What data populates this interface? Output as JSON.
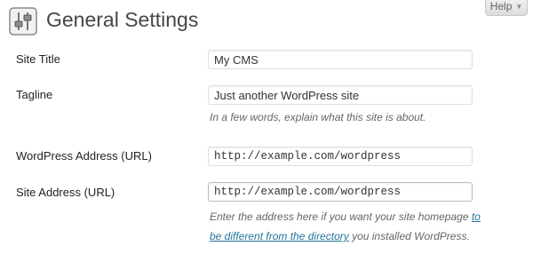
{
  "header": {
    "title": "General Settings",
    "icon": "settings-sliders-icon"
  },
  "help": {
    "label": "Help",
    "icon": "caret-down-icon"
  },
  "fields": {
    "site_title": {
      "label": "Site Title",
      "value": "My CMS"
    },
    "tagline": {
      "label": "Tagline",
      "value": "Just another WordPress site",
      "description": "In a few words, explain what this site is about."
    },
    "wp_address": {
      "label": "WordPress Address (URL)",
      "value": "http://example.com/wordpress"
    },
    "site_address": {
      "label": "Site Address (URL)",
      "value": "http://example.com/wordpress",
      "description_before": "Enter the address here if you want your site homepage ",
      "description_link": "to be different from the directory",
      "description_after": " you installed WordPress."
    }
  },
  "colors": {
    "link": "#21759b",
    "title": "#464646",
    "description": "#666666"
  }
}
